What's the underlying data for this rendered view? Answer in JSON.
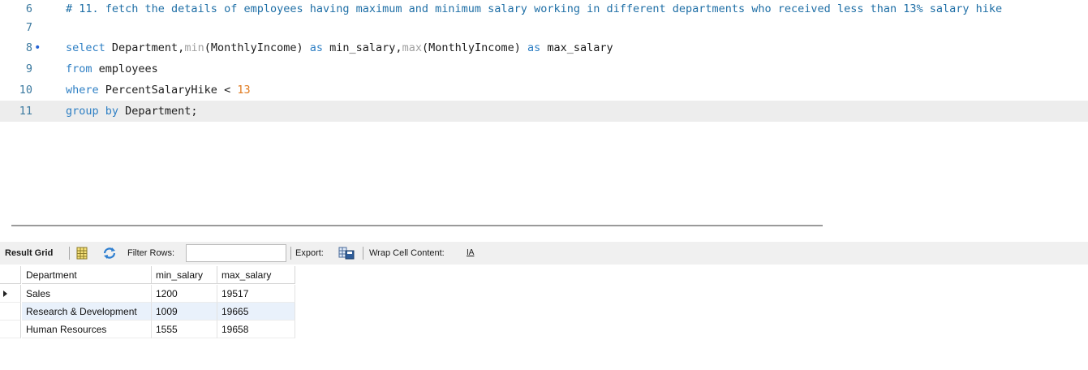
{
  "editor": {
    "lines": [
      {
        "num": "6",
        "comment": "# 11. fetch the details of employees having maximum and minimum salary working in different departments who received less than 13% salary hike"
      },
      {
        "num": "7"
      },
      {
        "num": "8",
        "marker": "•",
        "kw_select": "select",
        "t1": " Department,",
        "fn_min": "min",
        "t2": "(MonthlyIncome) ",
        "kw_as1": "as",
        "t3": " min_salary,",
        "fn_max": "max",
        "t4": "(MonthlyIncome) ",
        "kw_as2": "as",
        "t5": " max_salary"
      },
      {
        "num": "9",
        "kw_from": "from",
        "t1": " employees"
      },
      {
        "num": "10",
        "kw_where": "where",
        "t1": " PercentSalaryHike < ",
        "n1": "13"
      },
      {
        "num": "11",
        "kw_group": "group by",
        "t1": " Department;"
      }
    ]
  },
  "toolbar": {
    "result_grid_label": "Result Grid",
    "filter_rows_label": "Filter Rows:",
    "filter_value": "",
    "export_label": "Export:",
    "wrap_label": "Wrap Cell Content:",
    "wrap_icon_glyph": "IA"
  },
  "grid": {
    "columns": [
      "Department",
      "min_salary",
      "max_salary"
    ],
    "rows": [
      [
        "Sales",
        "1200",
        "19517"
      ],
      [
        "Research & Development",
        "1009",
        "19665"
      ],
      [
        "Human Resources",
        "1555",
        "19658"
      ]
    ]
  },
  "colors": {
    "keyword": "#2e7fc4",
    "function": "#a1a1a1",
    "number": "#e07a1f",
    "comment": "#1f6fa6",
    "current_line": "#ededed",
    "selected_row": "#e9f1fb"
  },
  "icons": {
    "grid_view": "grid-view-icon",
    "refresh": "refresh-icon",
    "export": "export-icon",
    "wrap": "wrap-cell-icon"
  }
}
